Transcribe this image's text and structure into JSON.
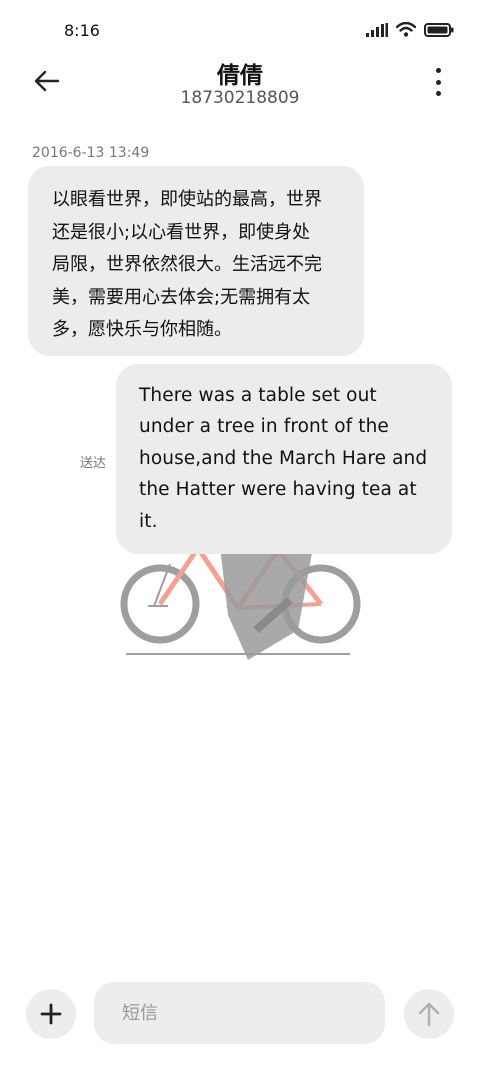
{
  "status_bar": {
    "time": "8:16",
    "icons": [
      "signal-icon",
      "wifi-icon",
      "battery-icon"
    ]
  },
  "header": {
    "contact_name": "倩倩",
    "phone_number": "18730218809",
    "back_icon": "arrow-left-icon",
    "more_icon": "more-vertical-icon"
  },
  "conversation": {
    "timestamp": "2016-6-13 13:49",
    "messages": [
      {
        "direction": "incoming",
        "lines": [
          "以眼看世界，即使站的最高，世界",
          "还是很小;以心看世界，即使身处",
          "局限，世界依然很大。生活远不完",
          "美，需要用心去体会;无需拥有太",
          "多，愿快乐与你相随。"
        ]
      },
      {
        "direction": "outgoing",
        "lines": [
          "There was a table set out",
          "under a tree in front of the",
          "house,and the March Hare and",
          "the Hatter were having tea at",
          "it."
        ],
        "status": "送达"
      }
    ]
  },
  "composer": {
    "placeholder": "短信",
    "value": "",
    "add_icon": "plus-icon",
    "send_icon": "arrow-up-icon"
  },
  "colors": {
    "bubble_bg": "#ececec",
    "accent_bike": "#f4a192",
    "illustration_gray": "#a8a8a8"
  }
}
